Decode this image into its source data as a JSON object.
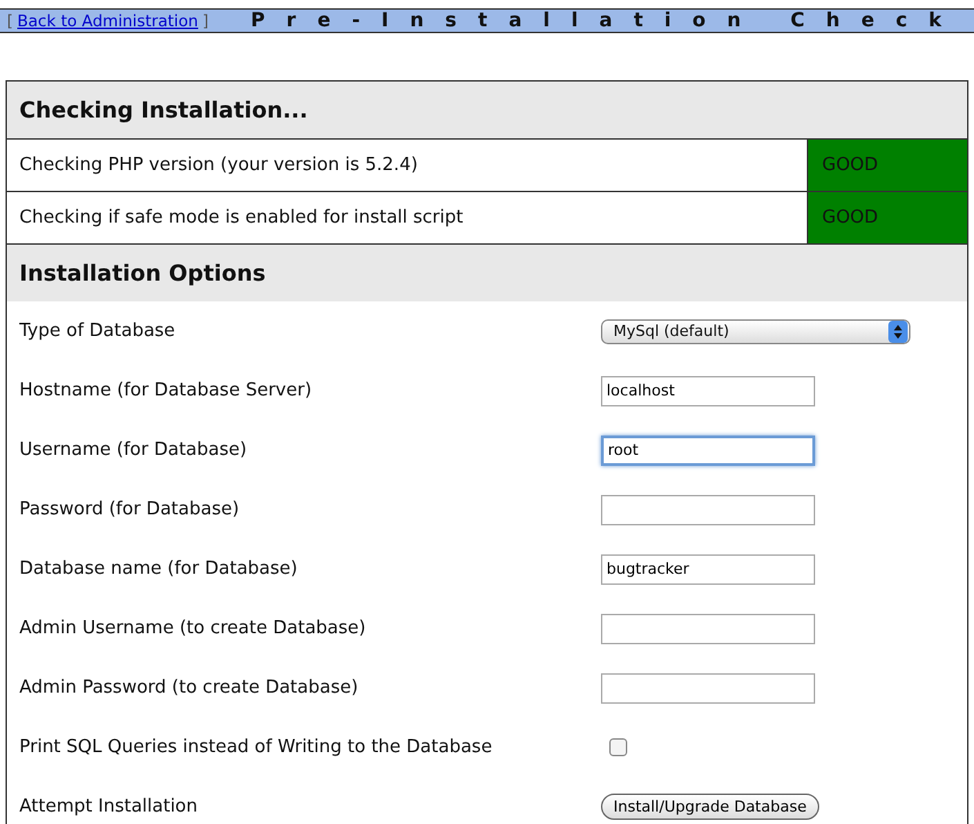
{
  "header": {
    "bracket_open": "[",
    "back_link": "Back to Administration",
    "bracket_close": "]",
    "title": "Pre-Installation Check"
  },
  "checks": {
    "title": "Checking Installation...",
    "rows": [
      {
        "label": "Checking PHP version (your version is 5.2.4)",
        "status": "GOOD",
        "color": "#008000"
      },
      {
        "label": "Checking if safe mode is enabled for install script",
        "status": "GOOD",
        "color": "#008000"
      }
    ]
  },
  "options": {
    "title": "Installation Options",
    "rows": [
      {
        "kind": "select",
        "label": "Type of Database",
        "value": "MySql (default)"
      },
      {
        "kind": "text",
        "label": "Hostname (for Database Server)",
        "value": "localhost",
        "focused": false
      },
      {
        "kind": "text",
        "label": "Username (for Database)",
        "value": "root",
        "focused": true
      },
      {
        "kind": "text",
        "label": "Password (for Database)",
        "focused": false
      },
      {
        "kind": "text",
        "label": "Database name (for Database)",
        "value": "bugtracker",
        "focused": false
      },
      {
        "kind": "text",
        "label": "Admin Username (to create Database)",
        "focused": false
      },
      {
        "kind": "text",
        "label": "Admin Password (to create Database)",
        "focused": false
      },
      {
        "kind": "checkbox",
        "label": "Print SQL Queries instead of Writing to the Database",
        "checked": false
      },
      {
        "kind": "button",
        "label": "Attempt Installation",
        "button": "Install/Upgrade Database"
      }
    ]
  }
}
